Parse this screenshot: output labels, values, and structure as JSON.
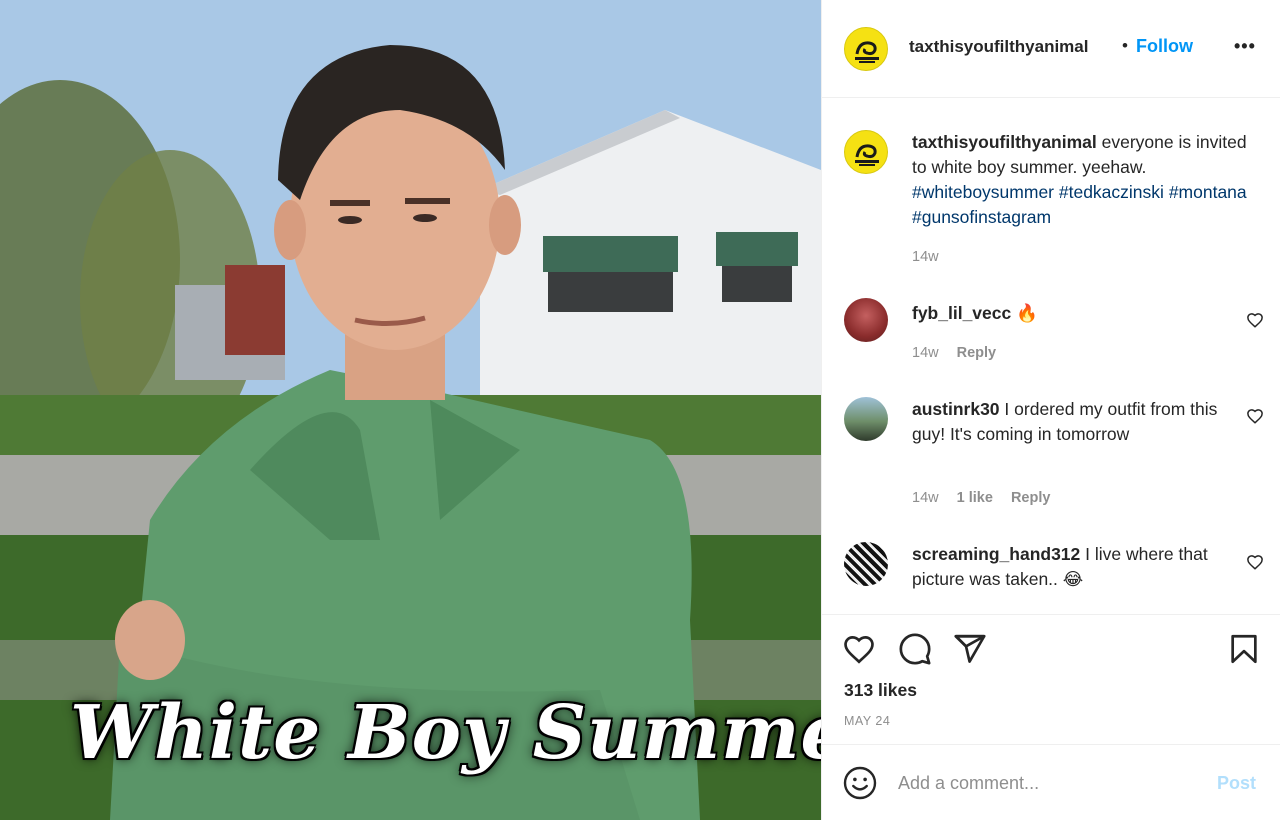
{
  "photo": {
    "caption_text": "White Boy Summer"
  },
  "post": {
    "username": "taxthisyoufilthyanimal",
    "follow_label": "Follow",
    "dot": "•",
    "more_label": "•••",
    "caption": {
      "username": "taxthisyoufilthyanimal",
      "text": "everyone is invited to white boy summer. yeehaw.",
      "hashtags": [
        "#whiteboysummer",
        "#tedkaczinski",
        "#montana",
        "#gunsofinstagram"
      ],
      "time": "14w"
    },
    "comments": [
      {
        "username": "fyb_lil_vecc",
        "text": "🔥",
        "time": "14w",
        "likes": "",
        "reply_label": "Reply"
      },
      {
        "username": "austinrk30",
        "text": "I ordered my outfit from this guy! It's coming in tomorrow",
        "time": "14w",
        "likes": "1 like",
        "reply_label": "Reply"
      },
      {
        "username": "screaming_hand312",
        "text": "I live where that picture was taken.. 😂",
        "time": "",
        "likes": "",
        "reply_label": ""
      }
    ],
    "likes_count": "313 likes",
    "date": "MAY 24"
  },
  "composer": {
    "placeholder": "Add a comment...",
    "post_label": "Post"
  },
  "colors": {
    "accent": "#0095f6",
    "hashtag": "#00376b",
    "muted": "#8e8e8e",
    "brand_avatar": "#f5e113",
    "post_disabled": "#b2dffc"
  },
  "icons": [
    "heart-icon",
    "comment-icon",
    "share-icon",
    "bookmark-icon",
    "emoji-icon",
    "more-icon"
  ]
}
